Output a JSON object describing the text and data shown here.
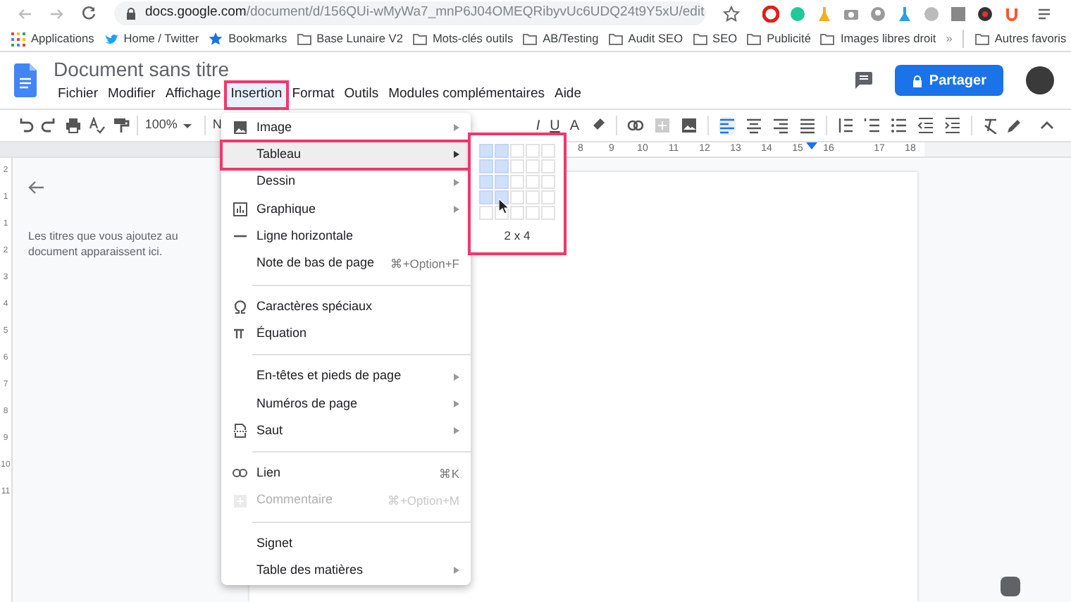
{
  "browser": {
    "url_host": "docs.google.com",
    "url_path": "/document/d/156QUi-wMyWa7_mnP6J04OMEQRibyvUc6UDQ24t9Y5xU/edit"
  },
  "bookmarks": [
    {
      "label": "Applications",
      "kind": "apps"
    },
    {
      "label": "Home / Twitter",
      "kind": "bird"
    },
    {
      "label": "Bookmarks",
      "kind": "star"
    },
    {
      "label": "Base Lunaire V2",
      "kind": "folder"
    },
    {
      "label": "Mots-clés outils",
      "kind": "folder"
    },
    {
      "label": "AB/Testing",
      "kind": "folder"
    },
    {
      "label": "Audit SEO",
      "kind": "folder"
    },
    {
      "label": "SEO",
      "kind": "folder"
    },
    {
      "label": "Publicité",
      "kind": "folder"
    },
    {
      "label": "Images libres droit",
      "kind": "folder"
    }
  ],
  "bookmarks_more": "»",
  "other_bookmarks": "Autres favoris",
  "document": {
    "title": "Document sans titre"
  },
  "menu_bar": [
    {
      "label": "Fichier",
      "selected": false
    },
    {
      "label": "Modifier",
      "selected": false
    },
    {
      "label": "Affichage",
      "selected": false
    },
    {
      "label": "Insertion",
      "selected": true
    },
    {
      "label": "Format",
      "selected": false
    },
    {
      "label": "Outils",
      "selected": false
    },
    {
      "label": "Modules complémentaires",
      "selected": false
    },
    {
      "label": "Aide",
      "selected": false
    }
  ],
  "share_button": "Partager",
  "toolbar": {
    "zoom": "100%",
    "style": "N",
    "format_buttons": [
      "I",
      "U"
    ],
    "text_color": "A",
    "alignments": [
      {
        "selected": true
      },
      {
        "selected": false
      },
      {
        "selected": false
      },
      {
        "selected": false
      }
    ]
  },
  "ruler": [
    "8",
    "9",
    "10",
    "11",
    "12",
    "13",
    "14",
    "15",
    "16",
    "17",
    "18"
  ],
  "vertical_ruler": [
    "2",
    "1",
    "1",
    "2",
    "3",
    "4",
    "5",
    "6",
    "7",
    "8",
    "9",
    "10",
    "11"
  ],
  "outline": {
    "hint": "Les titres que vous ajoutez au document apparaissent ici."
  },
  "insert_menu": [
    [
      {
        "label": "Image",
        "submenu": true,
        "disabled": false,
        "selected": false
      },
      {
        "label": "Tableau",
        "submenu": true,
        "disabled": false,
        "selected": true
      },
      {
        "label": "Dessin",
        "submenu": true,
        "disabled": false,
        "selected": false
      },
      {
        "label": "Graphique",
        "submenu": true,
        "disabled": false,
        "selected": false
      },
      {
        "label": "Ligne horizontale",
        "submenu": false,
        "disabled": false,
        "selected": false
      },
      {
        "label": "Note de bas de page",
        "shortcut": "⌘+Option+F",
        "submenu": false,
        "disabled": false,
        "selected": false
      }
    ],
    [
      {
        "label": "Caractères spéciaux",
        "submenu": false,
        "disabled": false,
        "selected": false
      },
      {
        "label": "Équation",
        "submenu": false,
        "disabled": false,
        "selected": false
      }
    ],
    [
      {
        "label": "En-têtes et pieds de page",
        "submenu": true,
        "disabled": false,
        "selected": false
      },
      {
        "label": "Numéros de page",
        "submenu": true,
        "disabled": false,
        "selected": false
      },
      {
        "label": "Saut",
        "submenu": true,
        "disabled": false,
        "selected": false
      }
    ],
    [
      {
        "label": "Lien",
        "shortcut": "⌘K",
        "submenu": false,
        "disabled": false,
        "selected": false
      },
      {
        "label": "Commentaire",
        "shortcut": "⌘+Option+M",
        "submenu": false,
        "disabled": true,
        "selected": false
      }
    ],
    [
      {
        "label": "Signet",
        "submenu": false,
        "disabled": false,
        "selected": false
      },
      {
        "label": "Table des matières",
        "submenu": true,
        "disabled": false,
        "selected": false
      }
    ]
  ],
  "table_picker": {
    "rows": [
      {
        "cells": [
          {
            "selected": true
          },
          {
            "selected": true
          },
          {
            "selected": false
          },
          {
            "selected": false
          },
          {
            "selected": false
          }
        ]
      },
      {
        "cells": [
          {
            "selected": true
          },
          {
            "selected": true
          },
          {
            "selected": false
          },
          {
            "selected": false
          },
          {
            "selected": false
          }
        ]
      },
      {
        "cells": [
          {
            "selected": true
          },
          {
            "selected": true
          },
          {
            "selected": false
          },
          {
            "selected": false
          },
          {
            "selected": false
          }
        ]
      },
      {
        "cells": [
          {
            "selected": true
          },
          {
            "selected": true
          },
          {
            "selected": false
          },
          {
            "selected": false
          },
          {
            "selected": false
          }
        ]
      },
      {
        "cells": [
          {
            "selected": false
          },
          {
            "selected": false
          },
          {
            "selected": false
          },
          {
            "selected": false
          },
          {
            "selected": false
          }
        ]
      }
    ],
    "size": "2 x 4"
  }
}
